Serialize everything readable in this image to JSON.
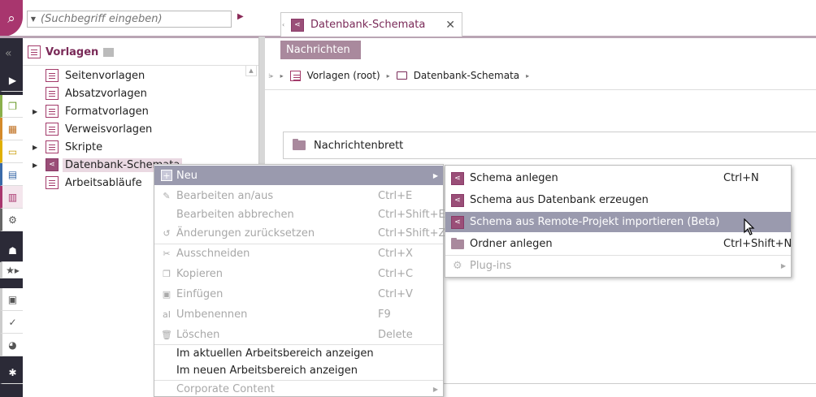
{
  "search": {
    "placeholder": "(Suchbegriff eingeben)"
  },
  "tab": {
    "title": "Datenbank-Schemata"
  },
  "tab_strip": {
    "active_sub": "Nachrichten"
  },
  "panel": {
    "title": "Vorlagen"
  },
  "tree": [
    {
      "label": "Seitenvorlagen",
      "expandable": false
    },
    {
      "label": "Absatzvorlagen",
      "expandable": false
    },
    {
      "label": "Formatvorlagen",
      "expandable": true
    },
    {
      "label": "Verweisvorlagen",
      "expandable": false
    },
    {
      "label": "Skripte",
      "expandable": true
    },
    {
      "label": "Datenbank-Schemata",
      "expandable": true,
      "selected": true
    },
    {
      "label": "Arbeitsabläufe",
      "expandable": false
    }
  ],
  "breadcrumb": {
    "root": "Vorlagen (root)",
    "current": "Datenbank-Schemata"
  },
  "content": {
    "folder": "Nachrichtenbrett"
  },
  "context_menu": [
    {
      "label": "Neu",
      "shortcut": "",
      "enabled": true,
      "highlighted": true,
      "submenu": true,
      "icon": "new-icon"
    },
    {
      "label": "Bearbeiten an/aus",
      "shortcut": "Ctrl+E",
      "enabled": false,
      "icon": "edit-icon"
    },
    {
      "label": "Bearbeiten abbrechen",
      "shortcut": "Ctrl+Shift+E",
      "enabled": false
    },
    {
      "label": "Änderungen zurücksetzen",
      "shortcut": "Ctrl+Shift+Z",
      "enabled": false,
      "icon": "undo-icon"
    },
    {
      "label": "Ausschneiden",
      "shortcut": "Ctrl+X",
      "enabled": false,
      "icon": "scissors-icon"
    },
    {
      "label": "Kopieren",
      "shortcut": "Ctrl+C",
      "enabled": false,
      "icon": "copy-icon"
    },
    {
      "label": "Einfügen",
      "shortcut": "Ctrl+V",
      "enabled": false,
      "icon": "paste-icon"
    },
    {
      "label": "Umbenennen",
      "shortcut": "F9",
      "enabled": false,
      "icon": "rename-icon"
    },
    {
      "label": "Löschen",
      "shortcut": "Delete",
      "enabled": false,
      "icon": "trash-icon"
    },
    {
      "label": "Im aktuellen Arbeitsbereich anzeigen",
      "shortcut": "",
      "enabled": true
    },
    {
      "label": "Im neuen Arbeitsbereich anzeigen",
      "shortcut": "",
      "enabled": true
    },
    {
      "label": "Corporate Content",
      "shortcut": "",
      "enabled": false,
      "submenu": true
    }
  ],
  "submenu": [
    {
      "label": "Schema anlegen",
      "shortcut": "Ctrl+N",
      "enabled": true
    },
    {
      "label": "Schema aus Datenbank erzeugen",
      "shortcut": "",
      "enabled": true
    },
    {
      "label": "Schema aus Remote-Projekt importieren (Beta)",
      "shortcut": "",
      "enabled": true,
      "highlighted": true
    },
    {
      "label": "Ordner anlegen",
      "shortcut": "Ctrl+Shift+N",
      "enabled": true
    },
    {
      "label": "Plug-ins",
      "shortcut": "",
      "enabled": false,
      "submenu": true
    }
  ],
  "colors": {
    "accent": "#a8366e",
    "menu_highlight": "#9a9aae",
    "tab_sub": "#a9899d"
  }
}
